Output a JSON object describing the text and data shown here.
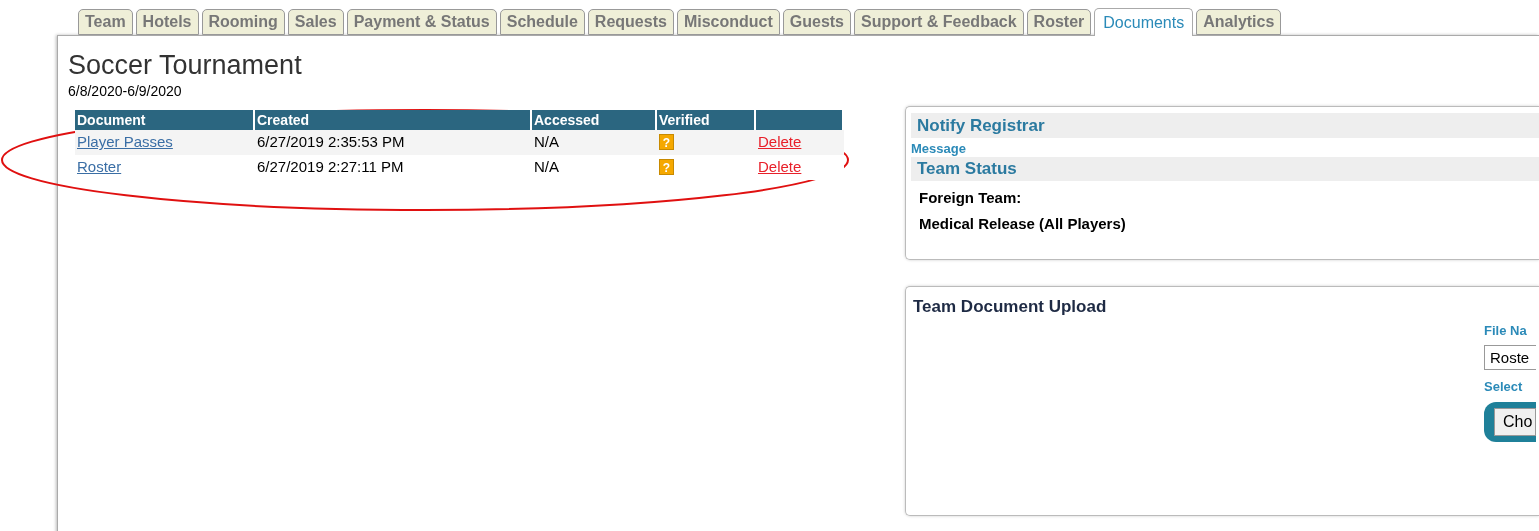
{
  "tabs": [
    {
      "label": "Team",
      "selected": false
    },
    {
      "label": "Hotels",
      "selected": false
    },
    {
      "label": "Rooming",
      "selected": false
    },
    {
      "label": "Sales",
      "selected": false
    },
    {
      "label": "Payment & Status",
      "selected": false
    },
    {
      "label": "Schedule",
      "selected": false
    },
    {
      "label": "Requests",
      "selected": false
    },
    {
      "label": "Misconduct",
      "selected": false
    },
    {
      "label": "Guests",
      "selected": false
    },
    {
      "label": "Support & Feedback",
      "selected": false
    },
    {
      "label": "Roster",
      "selected": false
    },
    {
      "label": "Documents",
      "selected": true
    },
    {
      "label": "Analytics",
      "selected": false
    }
  ],
  "event": {
    "title": "Soccer Tournament",
    "dates": "6/8/2020-6/9/2020"
  },
  "documents": {
    "columns": [
      "Document",
      "Created",
      "Accessed",
      "Verified",
      ""
    ],
    "rows": [
      {
        "document": "Player Passes",
        "created": "6/27/2019 2:35:53 PM",
        "accessed": "N/A",
        "verified_mark": "?",
        "action": "Delete"
      },
      {
        "document": "Roster",
        "created": "6/27/2019 2:27:11 PM",
        "accessed": "N/A",
        "verified_mark": "?",
        "action": "Delete"
      }
    ]
  },
  "notify": {
    "title": "Notify Registrar",
    "message_label": "Message"
  },
  "team_status": {
    "title": "Team Status",
    "items": [
      "Foreign Team:",
      "Medical Release (All Players)"
    ]
  },
  "upload": {
    "title": "Team Document Upload",
    "file_name_label": "File Na",
    "file_name_value": "Roste",
    "select_label": "Select",
    "choose_button": "Cho"
  }
}
